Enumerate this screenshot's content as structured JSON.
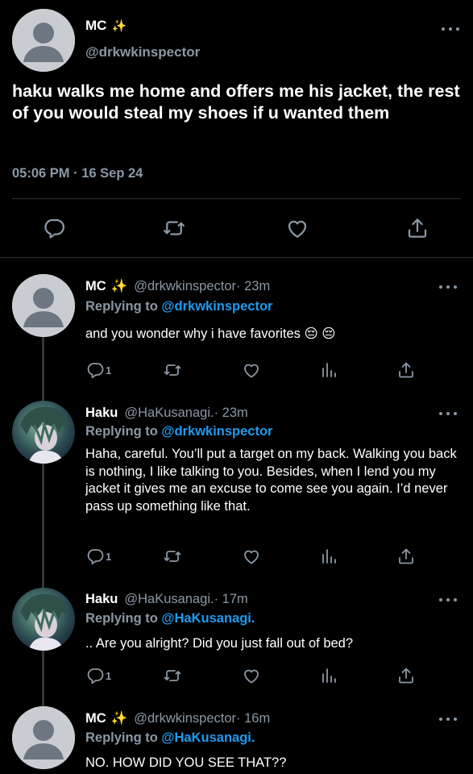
{
  "main_tweet": {
    "name": "MC",
    "sparkle": "✨",
    "handle": "@drkwkinspector",
    "text": "haku walks me home and offers me his jacket, the rest of you would steal my shoes if u wanted them",
    "timestamp": "05:06 PM · 16 Sep 24"
  },
  "replies": [
    {
      "name": "MC",
      "sparkle": "✨",
      "handle": "@drkwkinspector",
      "time": " · 23m",
      "replying_prefix": "Replying to ",
      "replying_to": "@drkwkinspector",
      "text": "and you wonder why i have favorites 😔 😔",
      "reply_count": "1"
    },
    {
      "name": "Haku",
      "sparkle": "",
      "handle": "@HaKusanagi.",
      "time": " · 23m",
      "replying_prefix": "Replying to ",
      "replying_to": "@drkwkinspector",
      "text": "Haha, careful. You’ll put a target on my back. Walking you back is nothing, I like talking to you. Besides, when I lend you my jacket it gives me an excuse to come see you again. I’d never pass up something like that.",
      "reply_count": "1"
    },
    {
      "name": "Haku",
      "sparkle": "",
      "handle": "@HaKusanagi.",
      "time": " · 17m",
      "replying_prefix": "Replying to ",
      "replying_to": "@HaKusanagi.",
      "text": ".. Are you alright? Did you just fall out of bed?",
      "reply_count": "1"
    },
    {
      "name": "MC",
      "sparkle": "✨",
      "handle": "@drkwkinspector",
      "time": " · 16m",
      "replying_prefix": "Replying to ",
      "replying_to": "@HaKusanagi.",
      "text": "NO. HOW DID YOU SEE THAT??",
      "reply_count": ""
    }
  ],
  "colors": {
    "background": "#000000",
    "text": "#ffffff",
    "secondary": "#8b98a5",
    "link": "#1d9bf0",
    "divider": "#2f3336"
  },
  "icons": [
    "more-icon",
    "reply-icon",
    "retweet-icon",
    "like-icon",
    "share-icon",
    "analytics-icon",
    "default-avatar-icon"
  ]
}
